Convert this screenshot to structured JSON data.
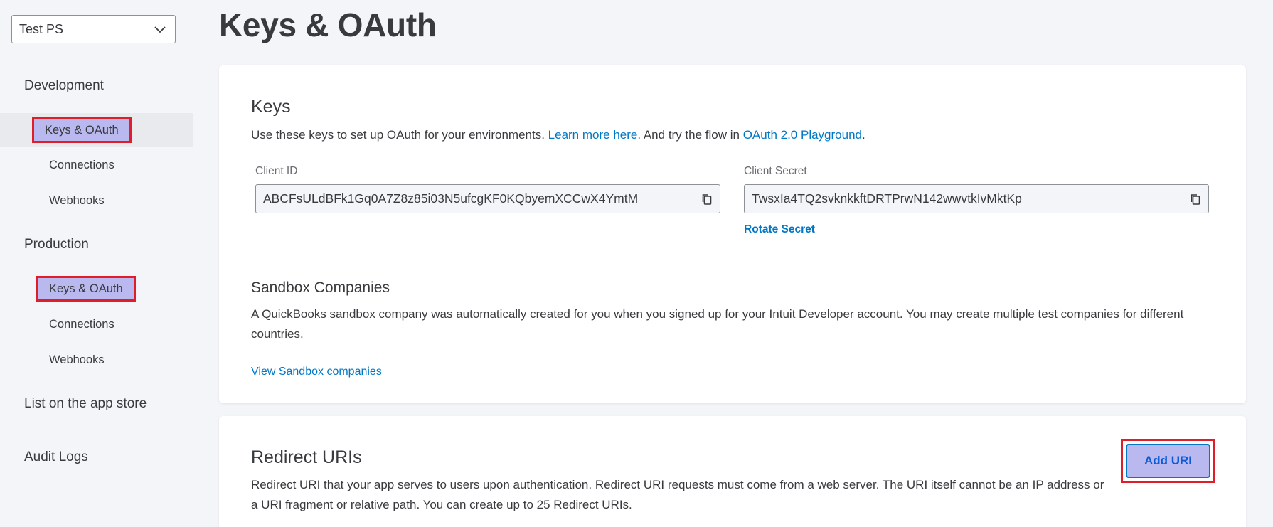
{
  "sidebar": {
    "app_select": "Test PS",
    "development_label": "Development",
    "production_label": "Production",
    "dev_items": [
      "Keys & OAuth",
      "Connections",
      "Webhooks"
    ],
    "prod_items": [
      "Keys & OAuth",
      "Connections",
      "Webhooks"
    ],
    "list_app_store": "List on the app store",
    "audit_logs": "Audit Logs"
  },
  "main": {
    "title": "Keys & OAuth",
    "keys": {
      "heading": "Keys",
      "desc_prefix": "Use these keys to set up OAuth for your environments. ",
      "learn_more": "Learn more here.",
      "desc_middle": " And try the flow in ",
      "playground": "OAuth 2.0 Playground",
      "desc_suffix": ".",
      "client_id_label": "Client ID",
      "client_id": "ABCFsULdBFk1Gq0A7Z8z85i03N5ufcgKF0KQbyemXCCwX4YmtM",
      "client_secret_label": "Client Secret",
      "client_secret": "TwsxIa4TQ2svknkkftDRTPrwN142wwvtkIvMktKp",
      "rotate_secret": "Rotate Secret"
    },
    "sandbox": {
      "heading": "Sandbox Companies",
      "desc": "A QuickBooks sandbox company was automatically created for you when you signed up for your Intuit Developer account. You may create multiple test companies for different countries.",
      "view_link": "View Sandbox companies"
    },
    "redirect": {
      "heading": "Redirect URIs",
      "desc": "Redirect URI that your app serves to users upon authentication. Redirect URI requests must come from a web server. The URI itself cannot be an IP address or a URI fragment or relative path. You can create up to 25 Redirect URIs.",
      "add_uri": "Add URI"
    }
  },
  "colors": {
    "accent_link": "#0077c5",
    "highlight_fill": "#b9b9f0",
    "highlight_border": "#e01e2a"
  }
}
